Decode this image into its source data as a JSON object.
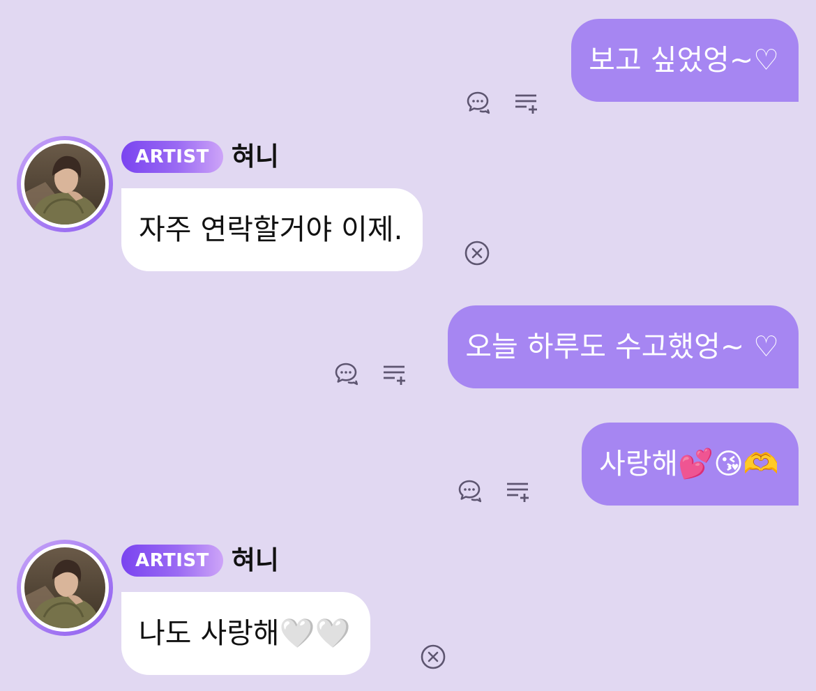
{
  "messages": [
    {
      "sender": "fan",
      "text": "보고 싶었엉~♡"
    },
    {
      "sender": "artist",
      "badge": "ARTIST",
      "name": "혀니",
      "text": "자주 연락할거야 이제."
    },
    {
      "sender": "fan",
      "text": "오늘 하루도 수고했엉~ ♡"
    },
    {
      "sender": "fan",
      "text": "사랑해💕😘🫶"
    },
    {
      "sender": "artist",
      "badge": "ARTIST",
      "name": "혀니",
      "text": "나도 사랑해🤍🤍"
    }
  ],
  "icons": {
    "comment": "chat-bubble-icon",
    "add_to_list": "playlist-add-icon",
    "dismiss": "close-circle-icon"
  },
  "colors": {
    "background": "#e1d8f2",
    "fan_bubble": "#a686f2",
    "artist_bubble": "#ffffff",
    "badge_gradient_start": "#7a44f0",
    "badge_gradient_end": "#cda4f8"
  }
}
